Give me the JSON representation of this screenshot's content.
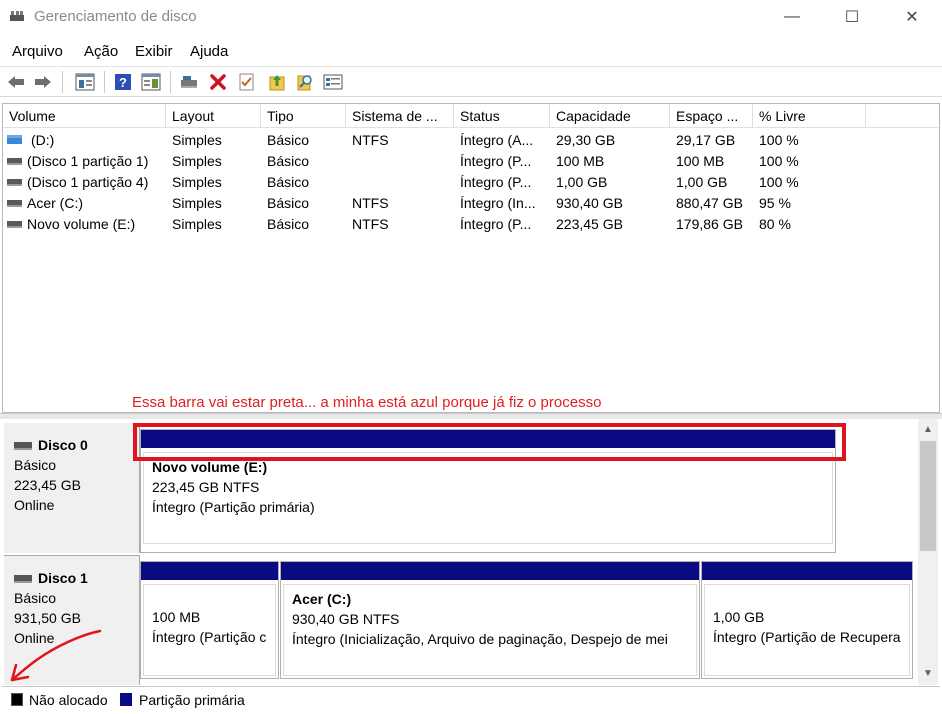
{
  "window": {
    "title": "Gerenciamento de disco",
    "minimize_glyph": "—",
    "maximize_glyph": "☐",
    "close_glyph": "✕"
  },
  "menu": [
    "Arquivo",
    "Ação",
    "Exibir",
    "Ajuda"
  ],
  "toolbar": {
    "icons": [
      "back-arrow-icon",
      "forward-arrow-icon",
      "properties-pane-icon",
      "help-icon",
      "console-view-icon",
      "connect-drive-icon",
      "delete-icon",
      "checklist-icon",
      "upload-icon",
      "search-icon",
      "details-icon"
    ]
  },
  "volume_list": {
    "columns": [
      "Volume",
      "Layout",
      "Tipo",
      "Sistema de ...",
      "Status",
      "Capacidade",
      "Espaço ...",
      "% Livre"
    ],
    "rows": [
      {
        "volume": "(D:)",
        "layout": "Simples",
        "tipo": "Básico",
        "fs": "NTFS",
        "status": "Íntegro (A...",
        "capacidade": "29,30 GB",
        "espaco": "29,17 GB",
        "livre": "100 %",
        "icon": "blue-drive-icon"
      },
      {
        "volume": "(Disco 1 partição 1)",
        "layout": "Simples",
        "tipo": "Básico",
        "fs": "",
        "status": "Íntegro (P...",
        "capacidade": "100 MB",
        "espaco": "100 MB",
        "livre": "100 %",
        "icon": "drive-icon"
      },
      {
        "volume": "(Disco 1 partição 4)",
        "layout": "Simples",
        "tipo": "Básico",
        "fs": "",
        "status": "Íntegro (P...",
        "capacidade": "1,00 GB",
        "espaco": "1,00 GB",
        "livre": "100 %",
        "icon": "drive-icon"
      },
      {
        "volume": "Acer (C:)",
        "layout": "Simples",
        "tipo": "Básico",
        "fs": "NTFS",
        "status": "Íntegro (In...",
        "capacidade": "930,40 GB",
        "espaco": "880,47 GB",
        "livre": "95 %",
        "icon": "drive-icon"
      },
      {
        "volume": "Novo volume (E:)",
        "layout": "Simples",
        "tipo": "Básico",
        "fs": "NTFS",
        "status": "Íntegro (P...",
        "capacidade": "223,45 GB",
        "espaco": "179,86 GB",
        "livre": "80 %",
        "icon": "drive-icon"
      }
    ]
  },
  "annotation": "Essa barra vai estar preta... a minha está azul porque já fiz o processo",
  "disks": [
    {
      "name": "Disco 0",
      "type": "Básico",
      "size": "223,45 GB",
      "state": "Online",
      "partitions": [
        {
          "title": "Novo volume  (E:)",
          "line2": "223,45 GB NTFS",
          "line3": "Íntegro (Partição primária)"
        }
      ]
    },
    {
      "name": "Disco 1",
      "type": "Básico",
      "size": "931,50 GB",
      "state": "Online",
      "partitions": [
        {
          "title": "",
          "line2": "100 MB",
          "line3": "Íntegro (Partição c"
        },
        {
          "title": "Acer  (C:)",
          "line2": "930,40 GB NTFS",
          "line3": "Íntegro (Inicialização, Arquivo de paginação, Despejo de mei"
        },
        {
          "title": "",
          "line2": "1,00 GB",
          "line3": "Íntegro (Partição de Recupera"
        }
      ]
    }
  ],
  "legend": {
    "unallocated": "Não alocado",
    "primary": "Partição primária",
    "colors": {
      "unallocated": "#000000",
      "primary": "#0a0a82"
    }
  },
  "colors": {
    "annotation": "#e02020",
    "highlight_box": "#e0141e",
    "partition_bar": "#0a0a82"
  }
}
